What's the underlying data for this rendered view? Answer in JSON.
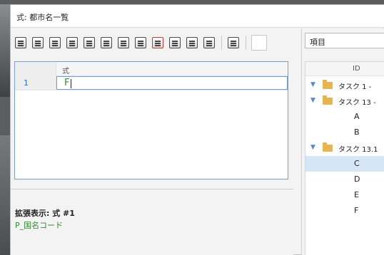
{
  "window": {
    "title": "式: 都市名一覧"
  },
  "formula_grid": {
    "column_header": "式",
    "rows": [
      {
        "number": "1",
        "formula": "F"
      }
    ]
  },
  "expanded_view": {
    "label": "拡張表示: 式 #1",
    "value": "P_国名コード"
  },
  "right_panel": {
    "dropdown": {
      "selected": "項目"
    },
    "tree": {
      "column_header": "ID",
      "items": [
        {
          "label": "タスク 1 -",
          "kind": "group"
        },
        {
          "label": "タスク 13 -",
          "kind": "group"
        },
        {
          "label": "A",
          "kind": "leaf"
        },
        {
          "label": "B",
          "kind": "leaf"
        },
        {
          "label": "タスク 13.1",
          "kind": "group"
        },
        {
          "label": "C",
          "kind": "leaf",
          "selected": true
        },
        {
          "label": "D",
          "kind": "leaf"
        },
        {
          "label": "E",
          "kind": "leaf"
        },
        {
          "label": "F",
          "kind": "leaf"
        }
      ]
    }
  },
  "toolbar": {
    "icons": [
      "insert-icon",
      "edit-icon",
      "edit-field-icon",
      "rename-icon",
      "table-icon",
      "calculator-icon",
      "list-icon",
      "search-icon",
      "delete-icon",
      "document-icon",
      "chart-icon",
      "note-icon",
      "insert-row-icon"
    ]
  }
}
